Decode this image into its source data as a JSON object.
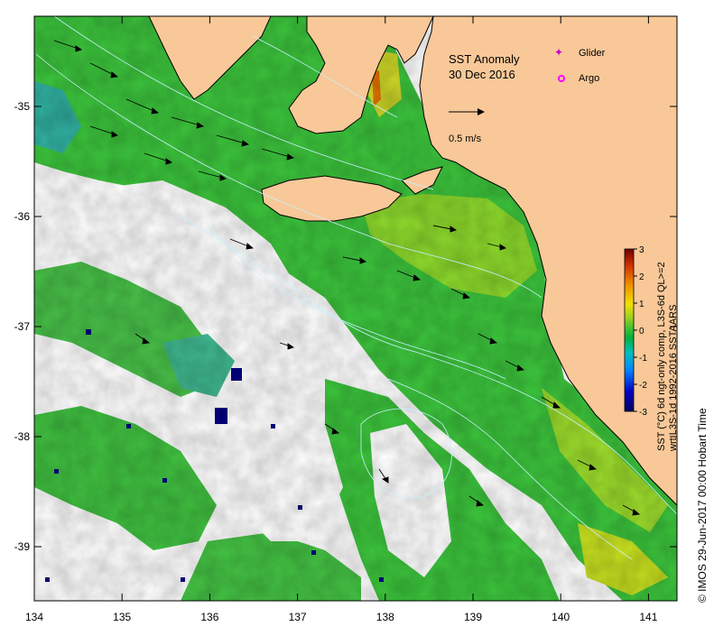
{
  "map": {
    "title": "SST Anomaly",
    "date": "30 Dec 2016",
    "legend_items": [
      {
        "label": "Glider",
        "color": "#cc00cc",
        "icon": "star-icon"
      },
      {
        "label": "Argo",
        "color": "#ff00ff",
        "icon": "ring-icon"
      }
    ],
    "scale_arrow_label": "0.5 m/s",
    "x_ticks": [
      "134",
      "135",
      "136",
      "137",
      "138",
      "139",
      "140",
      "141"
    ],
    "y_ticks": [
      "-35",
      "-36",
      "-37",
      "-38",
      "-39"
    ],
    "colorbar": {
      "ticks": [
        "3",
        "2",
        "1",
        "0",
        "-1",
        "-2",
        "-3"
      ],
      "label_line1": "SST (°C) 6d ngt-only comp, L3S-6d QL>=2",
      "label_line2": "wrt L3S-1d 1992-2016 SSTAARS"
    },
    "footer": "© IMOS 29-Jun-2017 00:00 Hobart Time",
    "colors": {
      "land": "#f8c898",
      "ocean_green": "#3cc43c",
      "ocean_yellow_green": "#8cd82c",
      "no_data": "#ffffff"
    }
  }
}
